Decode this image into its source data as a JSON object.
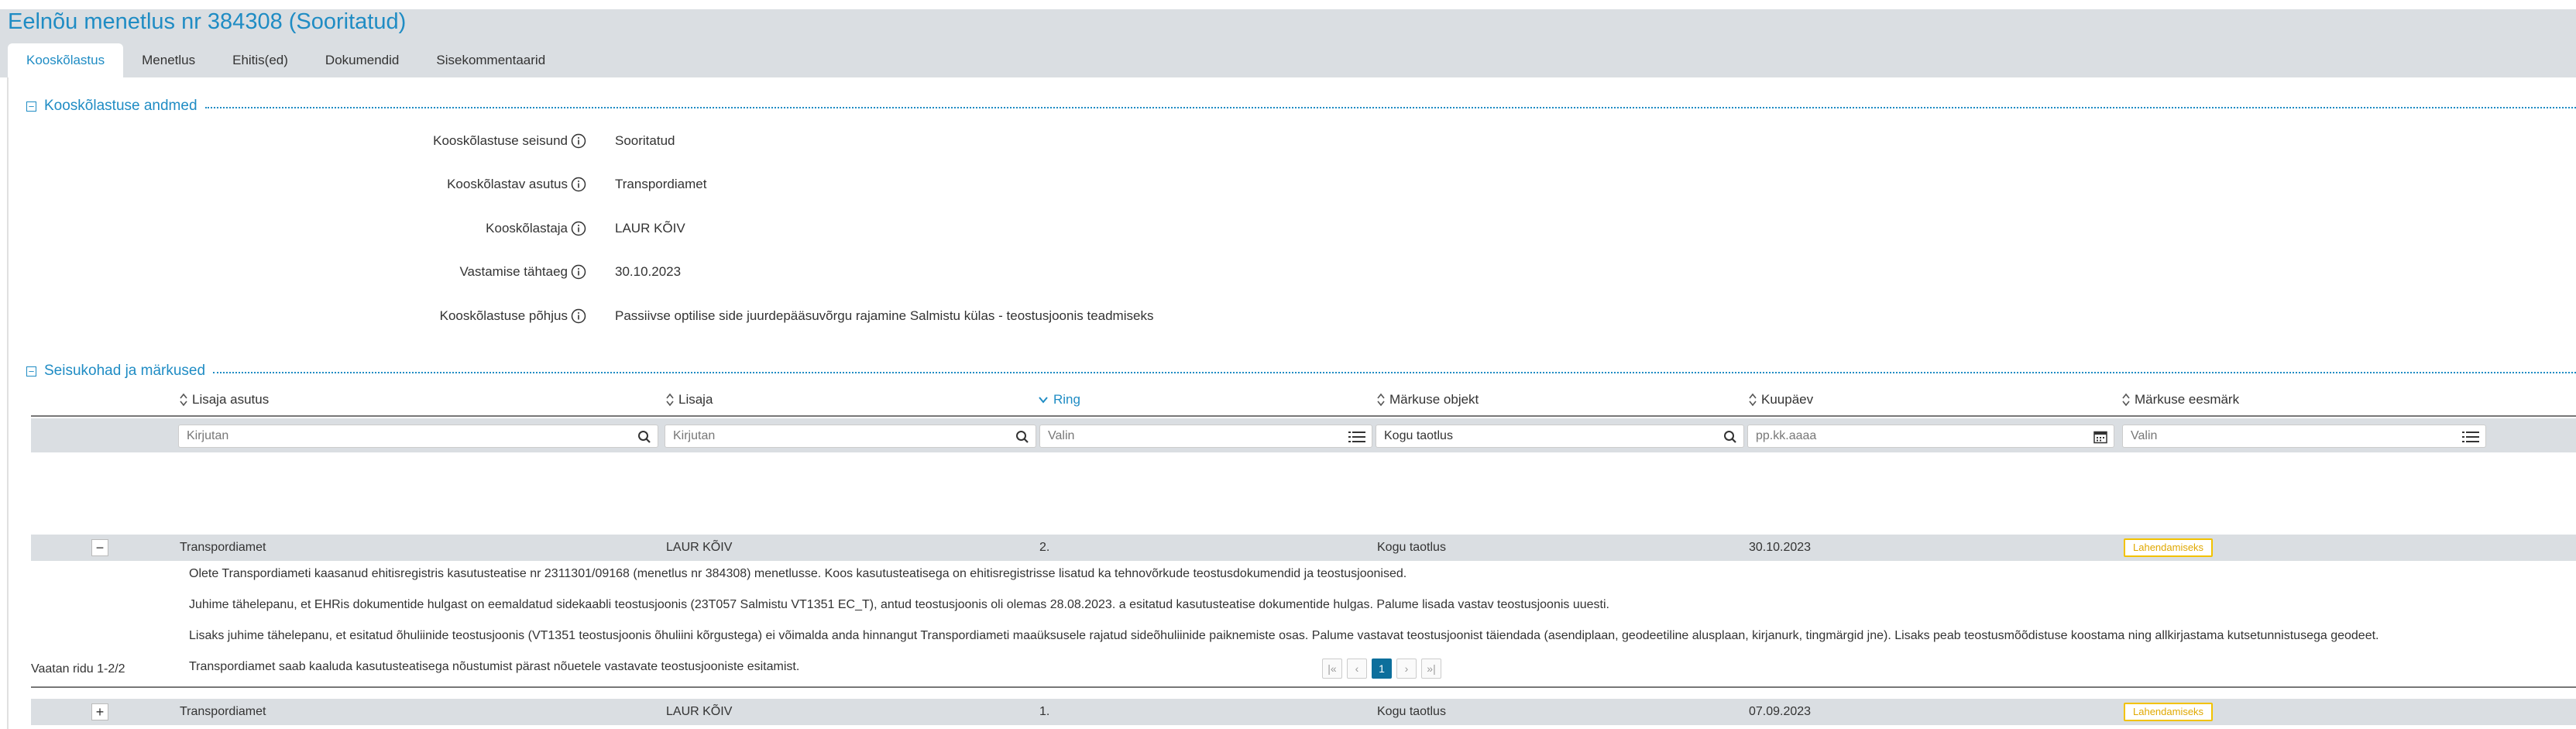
{
  "page": {
    "title": "Eelnõu menetlus nr 384308 (Sooritatud)"
  },
  "tabs": [
    {
      "label": "Kooskõlastus",
      "active": true
    },
    {
      "label": "Menetlus"
    },
    {
      "label": "Ehitis(ed)"
    },
    {
      "label": "Dokumendid"
    },
    {
      "label": "Sisekommentaarid"
    }
  ],
  "section1": {
    "collapse_symbol": "−",
    "title": "Kooskõlastuse andmed",
    "fields": [
      {
        "label": "Kooskõlastuse seisund",
        "value": "Sooritatud"
      },
      {
        "label": "Kooskõlastav asutus",
        "value": "Transpordiamet"
      },
      {
        "label": "Kooskõlastaja",
        "value": "LAUR KÕIV"
      },
      {
        "label": "Vastamise tähtaeg",
        "value": "30.10.2023"
      },
      {
        "label": "Kooskõlastuse põhjus",
        "value": "Passiivse optilise side juurdepääsuvõrgu rajamine Salmistu külas - teostusjoonis teadmiseks"
      }
    ]
  },
  "section2": {
    "collapse_symbol": "−",
    "title": "Seisukohad ja märkused",
    "columns": [
      {
        "label": "Lisaja asutus",
        "sorted": false
      },
      {
        "label": "Lisaja",
        "sorted": false
      },
      {
        "label": "Ring",
        "sorted": true
      },
      {
        "label": "Märkuse objekt",
        "sorted": false
      },
      {
        "label": "Kuupäev",
        "sorted": false
      },
      {
        "label": "Märkuse eesmärk",
        "sorted": false
      }
    ],
    "filters": {
      "asutus": {
        "placeholder": "Kirjutan",
        "value": "",
        "icon": "search-icon"
      },
      "lisaja": {
        "placeholder": "Kirjutan",
        "value": "",
        "icon": "search-icon"
      },
      "ring": {
        "placeholder": "Valin",
        "value": "",
        "icon": "list-icon"
      },
      "objekt": {
        "placeholder": "Kogu taotlus",
        "value": "Kogu taotlus",
        "icon": "search-icon"
      },
      "kuupaev": {
        "placeholder": "pp.kk.aaaa",
        "value": "",
        "icon": "calendar-icon"
      },
      "eesmark": {
        "placeholder": "Valin",
        "value": "",
        "icon": "list-icon"
      }
    },
    "rows": [
      {
        "expander": "−",
        "asutus": "Transpordiamet",
        "lisaja": "LAUR KÕIV",
        "ring": "2.",
        "objekt": "Kogu taotlus",
        "kuupaev": "30.10.2023",
        "eesmark": "Lahendamiseks",
        "remarks": [
          "Olete Transpordiameti kaasanud ehitisregistris kasutusteatise nr 2311301/09168 (menetlus nr 384308) menetlusse. Koos kasutusteatisega on ehitisregistrisse lisatud ka tehnovõrkude teostusdokumendid ja teostusjoonised.",
          "Juhime tähelepanu, et EHRis dokumentide hulgast on eemaldatud sidekaabli teostusjoonis (23T057 Salmistu VT1351 EC_T), antud teostusjoonis oli olemas 28.08.2023. a esitatud kasutusteatise dokumentide hulgas. Palume lisada vastav teostusjoonis uuesti.",
          "Lisaks juhime tähelepanu, et esitatud õhuliinide teostusjoonis (VT1351 teostusjoonis õhuliini kõrgustega) ei võimalda anda hinnangut Transpordiameti maaüksusele rajatud sideõhuliinide paiknemiste osas. Palume vastavat teostusjoonist täiendada (asendiplaan, geodeetiline alusplaan, kirjanurk, tingmärgid jne). Lisaks peab teostusmõõdistuse koostama ning allkirjastama kutsetunnistusega geodeet.",
          "Transpordiamet saab kaaluda kasutusteatisega nõustumist pärast nõuetele vastavate teostusjooniste esitamist."
        ]
      },
      {
        "expander": "+",
        "asutus": "Transpordiamet",
        "lisaja": "LAUR KÕIV",
        "ring": "1.",
        "objekt": "Kogu taotlus",
        "kuupaev": "07.09.2023",
        "eesmark": "Lahendamiseks"
      }
    ],
    "footer": {
      "row_count": "Vaatan ridu 1-2/2",
      "pager": {
        "first": "|«",
        "prev": "‹",
        "current": "1",
        "next": "›",
        "last": "»|"
      }
    }
  },
  "colors": {
    "accent": "#1f8cc4",
    "row_bg": "#dadee2",
    "badge_border": "#f2c200",
    "badge_text": "#e0a800",
    "pager_active": "#0d6f9c"
  }
}
